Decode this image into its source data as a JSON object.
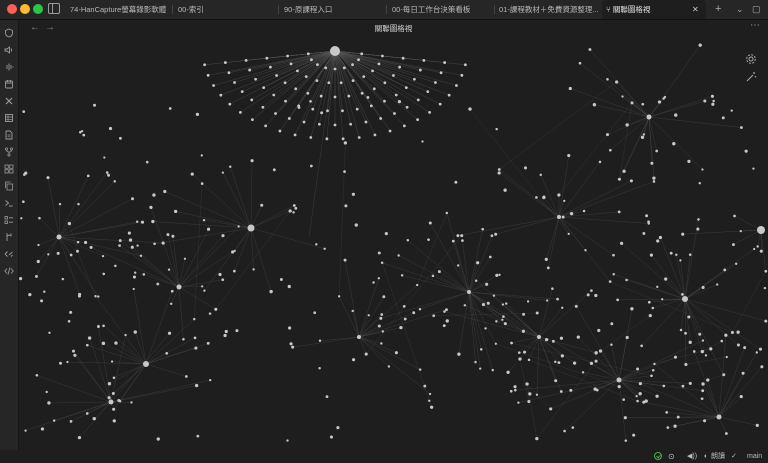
{
  "tabs": [
    {
      "label": "74-HanCapture螢幕錄影軟體"
    },
    {
      "label": "00-索引"
    },
    {
      "label": "90-原課程入口"
    },
    {
      "label": "00-每日工作台決策看板"
    },
    {
      "label": "01-課程教材＋免費資源整理..."
    },
    {
      "label": "關聯圖格視",
      "active": true
    }
  ],
  "toolbar": {
    "new_tab": "+",
    "tab_list": "⌄",
    "window_toggle": "▢"
  },
  "view": {
    "title": "關聯圖格視",
    "more": "⋯",
    "back": "←",
    "forward": "→"
  },
  "ribbon_icons": [
    "shield-icon",
    "volume-icon",
    "audio-wave-icon",
    "calendar-icon",
    "tools-icon",
    "table-icon",
    "file-icon",
    "fork-icon",
    "grid-icon",
    "copy-icon",
    "terminal-icon",
    "list-icon",
    "branch-icon",
    "regex-icon",
    "code-icon"
  ],
  "graph": {
    "controls": [
      "graph-settings-icon",
      "magic-wand-icon"
    ]
  },
  "status": {
    "reading_label": "朗讀",
    "branch": "main",
    "check": "✓"
  },
  "colors": {
    "accent": "#41b14b",
    "background": "#1e1e1e",
    "node": "#c8c8c8",
    "edge": "#5a5a5a"
  }
}
